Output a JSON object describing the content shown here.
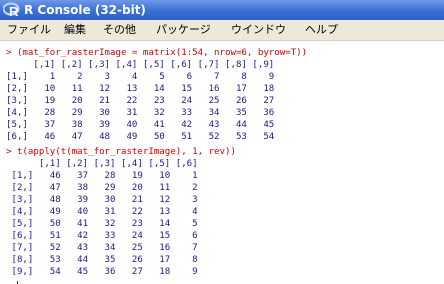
{
  "window": {
    "title": "R Console (32-bit)"
  },
  "menu": [
    "ファイル",
    "編集",
    "その他",
    "パッケージ",
    "ウインドウ",
    "ヘルプ"
  ],
  "console": {
    "lines": [
      {
        "type": "cmd",
        "text": "> (mat_for_rasterImage = matrix(1:54, nrow=6, byrow=T))"
      },
      {
        "type": "out",
        "text": "     [,1] [,2] [,3] [,4] [,5] [,6] [,7] [,8] [,9]"
      },
      {
        "type": "out",
        "text": "[1,]    1    2    3    4    5    6    7    8    9"
      },
      {
        "type": "out",
        "text": "[2,]   10   11   12   13   14   15   16   17   18"
      },
      {
        "type": "out",
        "text": "[3,]   19   20   21   22   23   24   25   26   27"
      },
      {
        "type": "out",
        "text": "[4,]   28   29   30   31   32   33   34   35   36"
      },
      {
        "type": "out",
        "text": "[5,]   37   38   39   40   41   42   43   44   45"
      },
      {
        "type": "out",
        "text": "[6,]   46   47   48   49   50   51   52   53   54"
      },
      {
        "type": "cmd",
        "text": "> t(apply(t(mat_for_rasterImage), 1, rev))"
      },
      {
        "type": "out",
        "text": "      [,1] [,2] [,3] [,4] [,5] [,6]"
      },
      {
        "type": "out",
        "text": " [1,]   46   37   28   19   10    1"
      },
      {
        "type": "out",
        "text": " [2,]   47   38   29   20   11    2"
      },
      {
        "type": "out",
        "text": " [3,]   48   39   30   21   12    3"
      },
      {
        "type": "out",
        "text": " [4,]   49   40   31   22   13    4"
      },
      {
        "type": "out",
        "text": " [5,]   50   41   32   23   14    5"
      },
      {
        "type": "out",
        "text": " [6,]   51   42   33   24   15    6"
      },
      {
        "type": "out",
        "text": " [7,]   52   43   34   25   16    7"
      },
      {
        "type": "out",
        "text": " [8,]   53   44   35   26   17    8"
      },
      {
        "type": "out",
        "text": " [9,]   54   45   36   27   18    9"
      }
    ],
    "prompt": "> "
  }
}
